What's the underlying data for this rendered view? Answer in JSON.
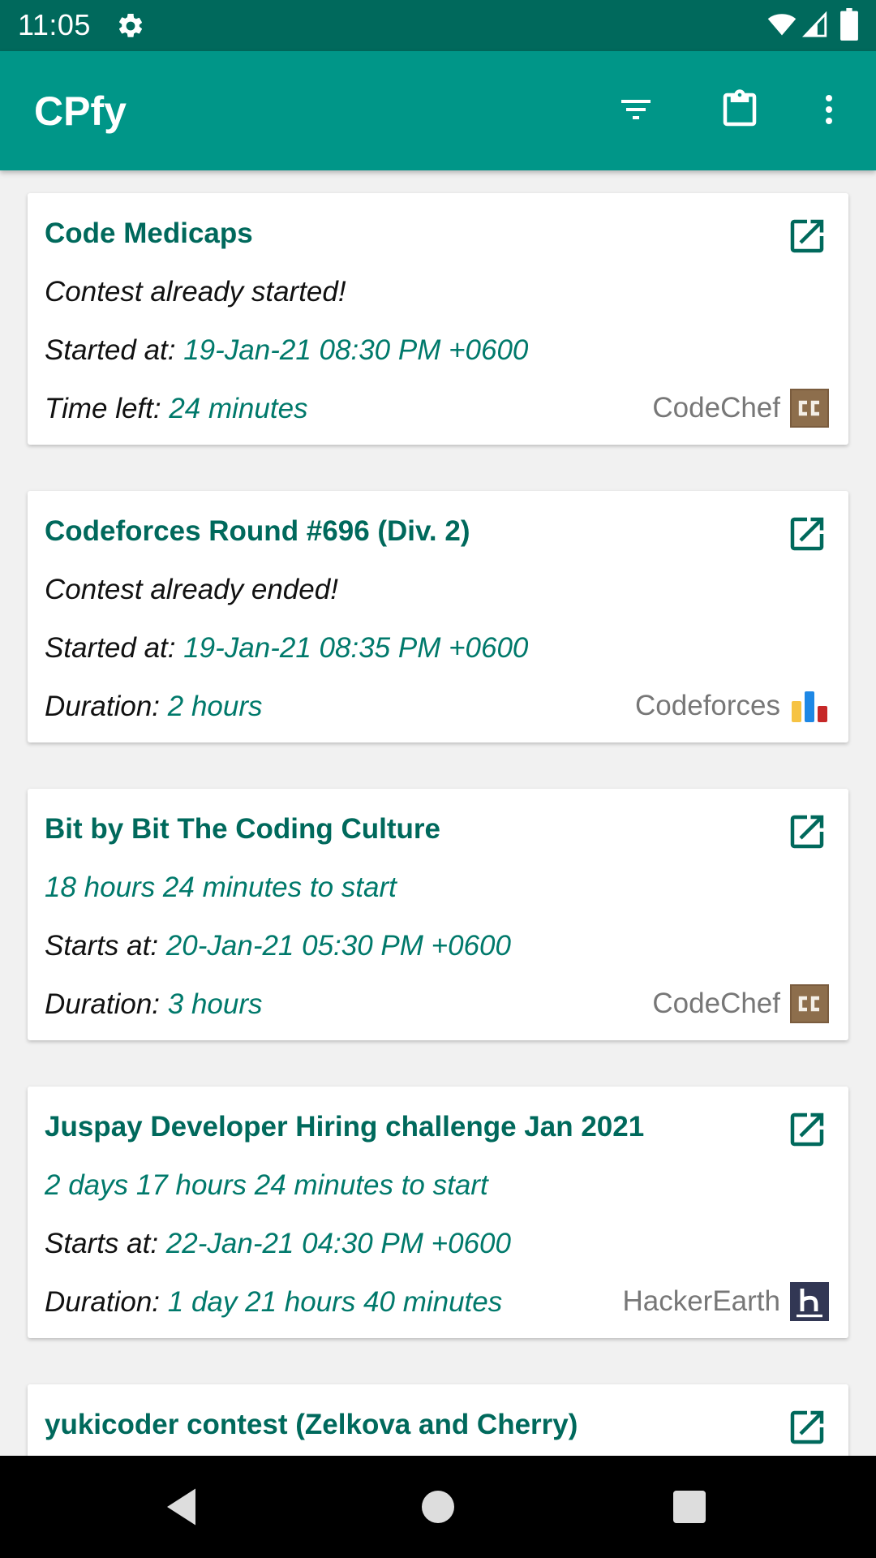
{
  "status_bar": {
    "time": "11:05",
    "icons": [
      "gear-icon",
      "wifi-icon",
      "cellular-signal-icon",
      "battery-icon"
    ]
  },
  "app_bar": {
    "title": "CPfy",
    "actions": [
      "filter-icon",
      "clipboard-icon",
      "more-vert-icon"
    ],
    "color": "#009688"
  },
  "contests": [
    {
      "title": "Code Medicaps",
      "status": "Contest already started!",
      "time_label": "Started at:",
      "time_value": "19-Jan-21 08:30 PM +0600",
      "extra_label": "Time left:",
      "extra_value": "24 minutes",
      "platform": "CodeChef",
      "platform_icon": "codechef-logo-icon"
    },
    {
      "title": "Codeforces Round #696 (Div. 2)",
      "status": "Contest already ended!",
      "time_label": "Started at:",
      "time_value": "19-Jan-21 08:35 PM +0600",
      "extra_label": "Duration:",
      "extra_value": "2 hours",
      "platform": "Codeforces",
      "platform_icon": "codeforces-logo-icon"
    },
    {
      "title": "Bit by Bit The Coding Culture",
      "status": "18 hours 24 minutes to start",
      "time_label": "Starts at:",
      "time_value": "20-Jan-21 05:30 PM +0600",
      "extra_label": "Duration:",
      "extra_value": "3 hours",
      "platform": "CodeChef",
      "platform_icon": "codechef-logo-icon"
    },
    {
      "title": "Juspay Developer Hiring challenge Jan 2021",
      "status": "2 days 17 hours 24 minutes to start",
      "time_label": "Starts at:",
      "time_value": "22-Jan-21 04:30 PM +0600",
      "extra_label": "Duration:",
      "extra_value": "1 day 21 hours 40 minutes",
      "platform": "HackerEarth",
      "platform_icon": "hackerearth-logo-icon"
    },
    {
      "title": "yukicoder contest (Zelkova and Cherry)"
    }
  ],
  "nav_bar": {
    "buttons": [
      "back-icon",
      "home-icon",
      "recents-icon"
    ]
  },
  "colors": {
    "status_bar": "#00695c",
    "accent_text": "#00695c",
    "value_text": "#00796b"
  }
}
